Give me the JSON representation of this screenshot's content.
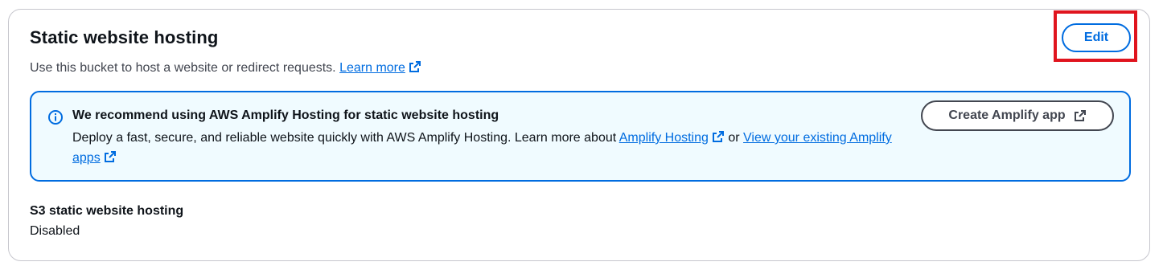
{
  "panel": {
    "title": "Static website hosting",
    "description": "Use this bucket to host a website or redirect requests.",
    "learn_more": "Learn more",
    "edit_label": "Edit"
  },
  "alert": {
    "icon": "info-icon",
    "title": "We recommend using AWS Amplify Hosting for static website hosting",
    "body_prefix": "Deploy a fast, secure, and reliable website quickly with AWS Amplify Hosting. Learn more about",
    "amplify_hosting_link": "Amplify Hosting",
    "or_text": "or",
    "view_apps_link": "View your existing Amplify apps",
    "button_label": "Create Amplify app"
  },
  "field": {
    "label": "S3 static website hosting",
    "value": "Disabled"
  },
  "colors": {
    "link": "#006ce0",
    "alert_bg": "#f0fbff",
    "alert_border": "#006ce0",
    "highlight": "#e0141e",
    "border": "#c6c6cd"
  }
}
